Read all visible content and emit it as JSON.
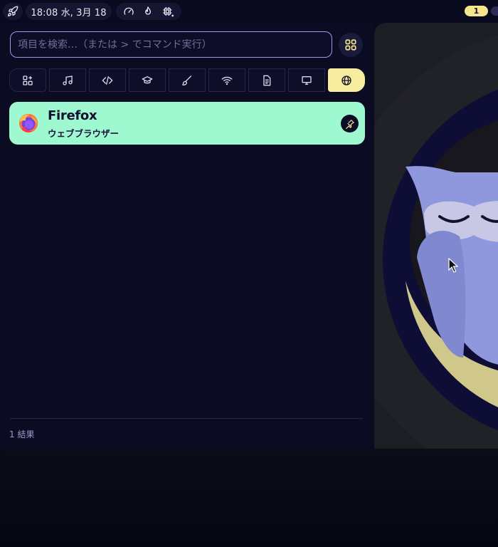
{
  "topbar": {
    "rocket_icon": "rocket-icon",
    "clock": "18:08 水, 3月 18",
    "gauge_icon": "gauge-icon",
    "flame_icon": "flame-icon",
    "cpu_icon": "cpu-icon",
    "workspace_active": "1"
  },
  "search": {
    "placeholder": "項目を検索…（または > でコマンド実行）",
    "value": ""
  },
  "categories": [
    {
      "id": "all",
      "icon": "apps-add-icon"
    },
    {
      "id": "music",
      "icon": "music-icon"
    },
    {
      "id": "development",
      "icon": "code-icon"
    },
    {
      "id": "education",
      "icon": "graduation-cap-icon"
    },
    {
      "id": "graphics",
      "icon": "brush-icon"
    },
    {
      "id": "network",
      "icon": "wifi-icon"
    },
    {
      "id": "office",
      "icon": "document-icon"
    },
    {
      "id": "system",
      "icon": "monitor-icon"
    },
    {
      "id": "internet",
      "icon": "globe-icon",
      "active": true
    }
  ],
  "results": [
    {
      "name": "Firefox",
      "description": "ウェブブラウザー",
      "icon": "firefox-icon",
      "pinned": false
    }
  ],
  "result_count": "1 結果",
  "colors": {
    "background": "#0b0b22",
    "accent_active_tab": "#f8ed9e",
    "result_highlight": "#9ef8d0",
    "search_border": "#9a9ae6",
    "workspace_badge": "#f6e58d"
  }
}
